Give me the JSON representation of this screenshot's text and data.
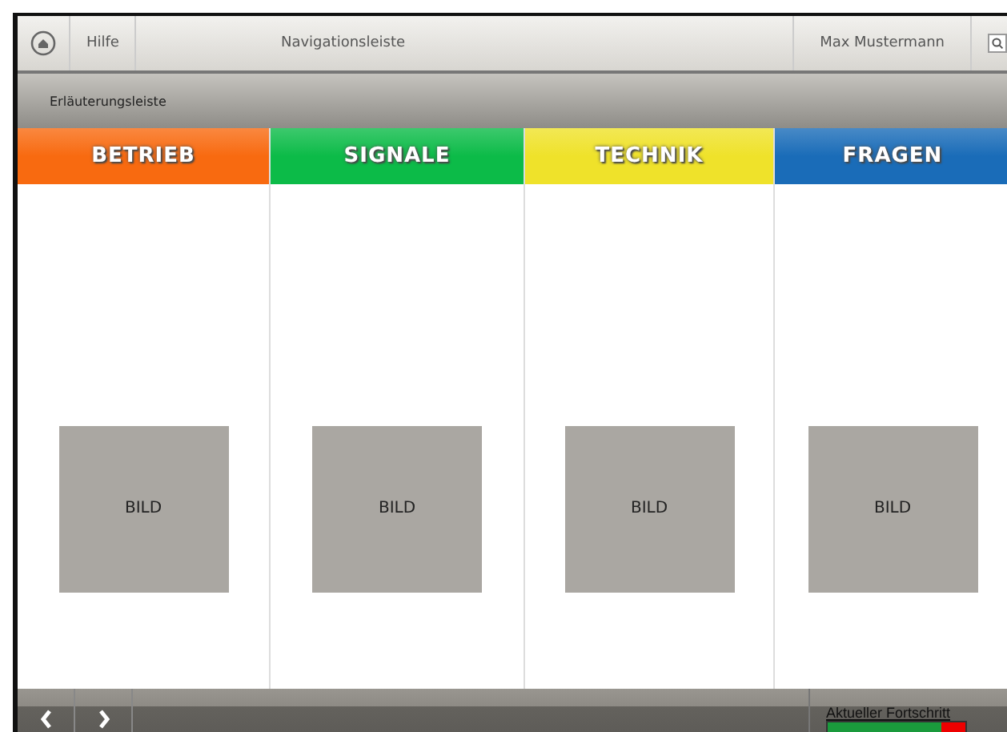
{
  "navigation_bar": {
    "help": "Hilfe",
    "title": "Navigationsleiste",
    "user": "Max Mustermann"
  },
  "explanation_bar": {
    "text": "Erläuterungsleiste"
  },
  "categories": [
    {
      "label": "BETRIEB",
      "color": "#f86a10",
      "image_label": "BILD"
    },
    {
      "label": "SIGNALE",
      "color": "#0cbb48",
      "image_label": "BILD"
    },
    {
      "label": "TECHNIK",
      "color": "#efe22a",
      "image_label": "BILD"
    },
    {
      "label": "FRAGEN",
      "color": "#1a6cb8",
      "image_label": "BILD"
    }
  ],
  "footer": {
    "progress_label": "Aktueller Fortschritt",
    "progress": {
      "level": 0.83
    }
  }
}
